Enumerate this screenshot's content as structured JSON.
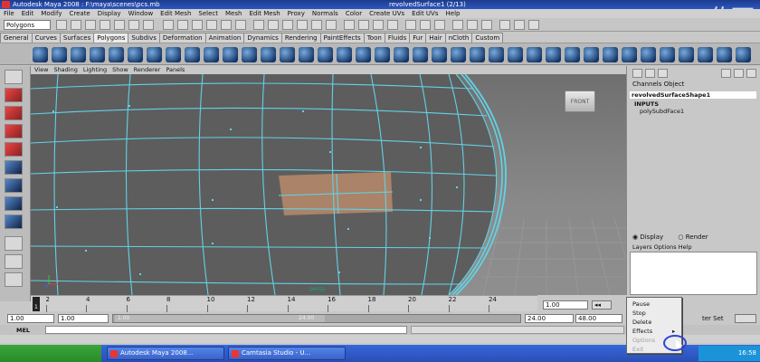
{
  "window": {
    "title": "Autodesk Maya 2008 : F:\\maya\\scenes\\pcs.mb",
    "title_right": "revolvedSurface1   (2/13)"
  },
  "watermark": "佐西",
  "menubar": [
    "File",
    "Edit",
    "Modify",
    "Create",
    "Display",
    "Window",
    "Edit Mesh",
    "Select",
    "Mesh",
    "Edit Mesh",
    "Proxy",
    "Normals",
    "Color",
    "Create UVs",
    "Edit UVs",
    "Help"
  ],
  "status_line": {
    "menu_set": "Polygons"
  },
  "shelf_tabs": [
    "General",
    "Curves",
    "Surfaces",
    "Polygons",
    "Subdivs",
    "Deformation",
    "Animation",
    "Dynamics",
    "Rendering",
    "PaintEffects",
    "Toon",
    "Fluids",
    "Fur",
    "Hair",
    "nCloth",
    "Custom"
  ],
  "active_shelf_tab": "Polygons",
  "panel_menu": [
    "View",
    "Shading",
    "Lighting",
    "Show",
    "Renderer",
    "Panels"
  ],
  "viewport": {
    "view_cube_label": "FRONT",
    "corner_tag": "persp"
  },
  "channel_box": {
    "tabs": [
      "Channels",
      "Object"
    ],
    "object_name": "revolvedSurfaceShape1",
    "inputs_label": "INPUTS",
    "input_node": "polySubdFace1"
  },
  "layer_editor": {
    "display_label": "Display",
    "render_label": "Render",
    "menus": [
      "Layers",
      "Options",
      "Help"
    ]
  },
  "time_slider": {
    "ticks": [
      "2",
      "4",
      "6",
      "8",
      "10",
      "12",
      "14",
      "16",
      "18",
      "20",
      "22",
      "24"
    ],
    "current_frame_field": "1.00",
    "current_frame": "1"
  },
  "range_slider": {
    "start_time": "1.00",
    "playback_start": "1.00",
    "handle_start": "1.00",
    "handle_end": "24.00",
    "playback_end": "24.00",
    "end_time": "48.00",
    "character_set_label": "ter Set"
  },
  "command_line": {
    "label": "MEL"
  },
  "context_menu": {
    "items": [
      {
        "label": "Pause",
        "disabled": false
      },
      {
        "label": "Stop",
        "disabled": false
      },
      {
        "label": "Delete",
        "disabled": false
      },
      {
        "label": "Effects",
        "disabled": false
      },
      {
        "label": "Options",
        "disabled": true
      },
      {
        "label": "Exit",
        "disabled": true
      }
    ]
  },
  "taskbar": {
    "buttons": [
      "Autodesk Maya 2008...",
      "Camtasia Studio - U..."
    ],
    "clock": "16:58"
  },
  "colors": {
    "wire": "#62d2e6",
    "selected_face": "#c4906c",
    "taskbar": "#2a4fb6"
  }
}
